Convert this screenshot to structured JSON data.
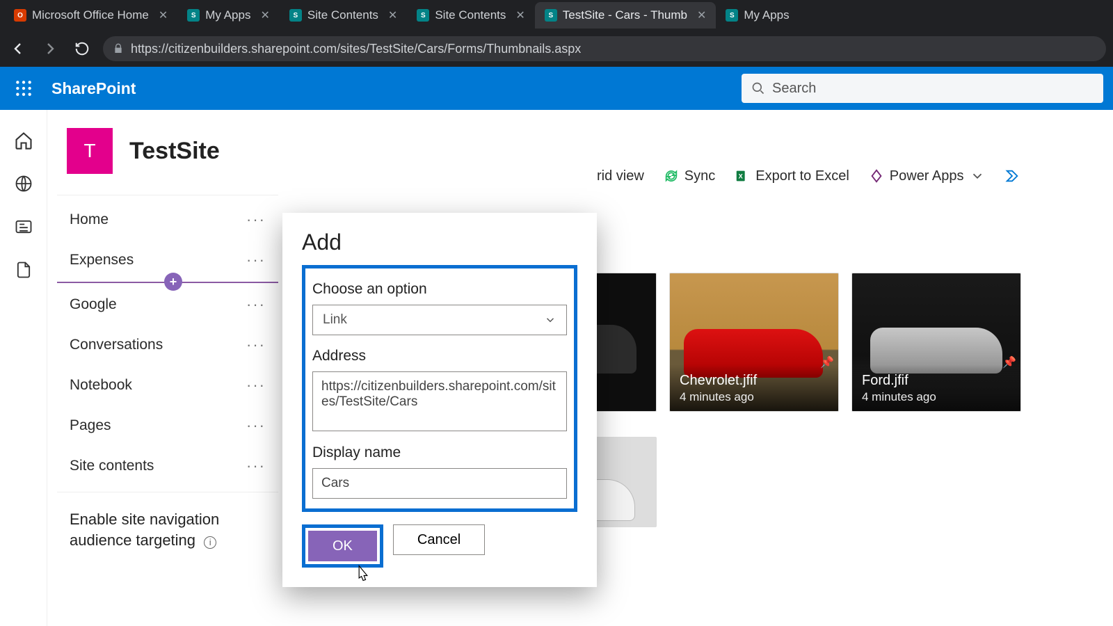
{
  "browser": {
    "tabs": [
      {
        "label": "Microsoft Office Home",
        "favicon_bg": "#d83b01",
        "favicon_txt": "O"
      },
      {
        "label": "My Apps",
        "favicon_bg": "#038387",
        "favicon_txt": "S"
      },
      {
        "label": "Site Contents",
        "favicon_bg": "#038387",
        "favicon_txt": "S"
      },
      {
        "label": "Site Contents",
        "favicon_bg": "#038387",
        "favicon_txt": "S"
      },
      {
        "label": "TestSite - Cars - Thumb",
        "favicon_bg": "#038387",
        "favicon_txt": "S",
        "active": true
      },
      {
        "label": "My Apps",
        "favicon_bg": "#038387",
        "favicon_txt": "S"
      }
    ],
    "url": "https://citizenbuilders.sharepoint.com/sites/TestSite/Cars/Forms/Thumbnails.aspx"
  },
  "header": {
    "brand": "SharePoint",
    "search_placeholder": "Search"
  },
  "site": {
    "logo_letter": "T",
    "title": "TestSite",
    "nav": [
      "Home",
      "Expenses",
      "Google",
      "Conversations",
      "Notebook",
      "Pages",
      "Site contents"
    ],
    "footer_l1": "Enable site navigation",
    "footer_l2": "audience targeting"
  },
  "commands": {
    "grid_view": "rid view",
    "sync": "Sync",
    "export": "Export to Excel",
    "powerapps": "Power Apps"
  },
  "tiles": [
    {
      "filename": "",
      "timestamp": ""
    },
    {
      "filename": "",
      "timestamp": ""
    },
    {
      "filename": "Chevrolet.jfif",
      "timestamp": "4 minutes ago"
    },
    {
      "filename": "Ford.jfif",
      "timestamp": "4 minutes ago"
    }
  ],
  "dialog": {
    "title": "Add",
    "option_label": "Choose an option",
    "option_value": "Link",
    "address_label": "Address",
    "address_value": "https://citizenbuilders.sharepoint.com/sites/TestSite/Cars",
    "display_label": "Display name",
    "display_value": "Cars",
    "ok": "OK",
    "cancel": "Cancel"
  }
}
